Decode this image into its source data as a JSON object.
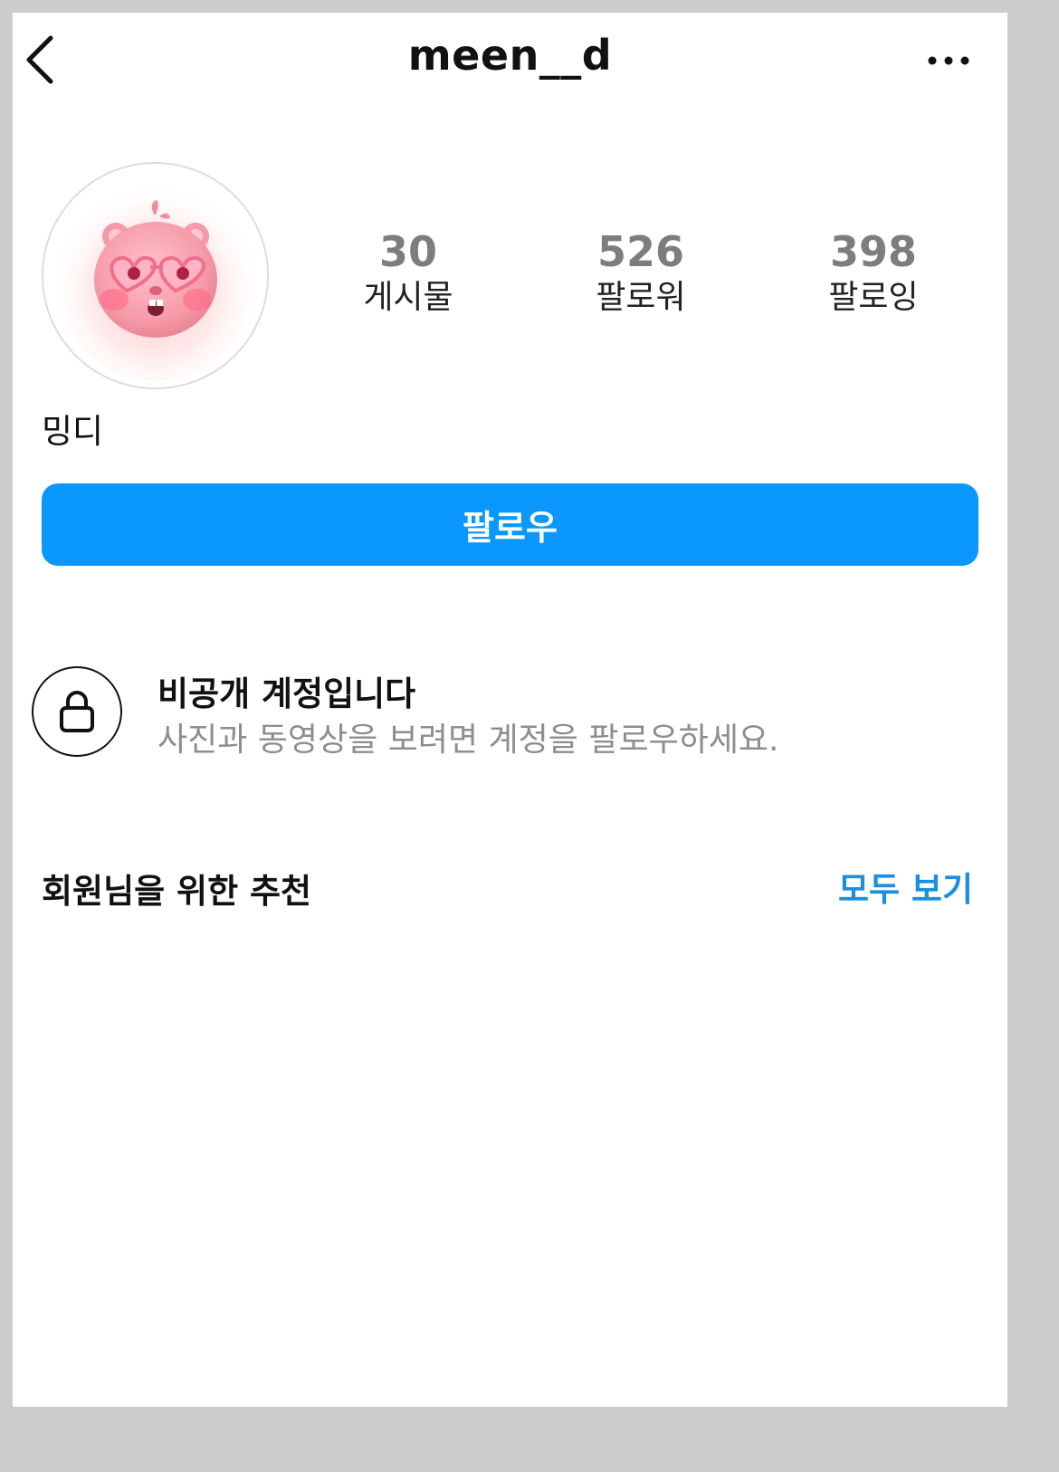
{
  "header": {
    "username": "meen__d",
    "back_icon": "chevron-left-icon",
    "more_icon": "more-horizontal-icon"
  },
  "profile": {
    "avatar_icon": "pink-hamster-avatar",
    "display_name": "밍디",
    "stats": [
      {
        "count": "30",
        "label": "게시물"
      },
      {
        "count": "526",
        "label": "팔로워"
      },
      {
        "count": "398",
        "label": "팔로잉"
      }
    ]
  },
  "actions": {
    "follow_label": "팔로우",
    "accent_color": "#0a98fe"
  },
  "private_notice": {
    "icon": "lock-icon",
    "title": "비공개 계정입니다",
    "subtitle": "사진과 동영상을 보려면 계정을 팔로우하세요."
  },
  "recommendations": {
    "title": "회원님을 위한 추천",
    "see_all_label": "모두 보기",
    "link_color": "#1a8fe0"
  }
}
